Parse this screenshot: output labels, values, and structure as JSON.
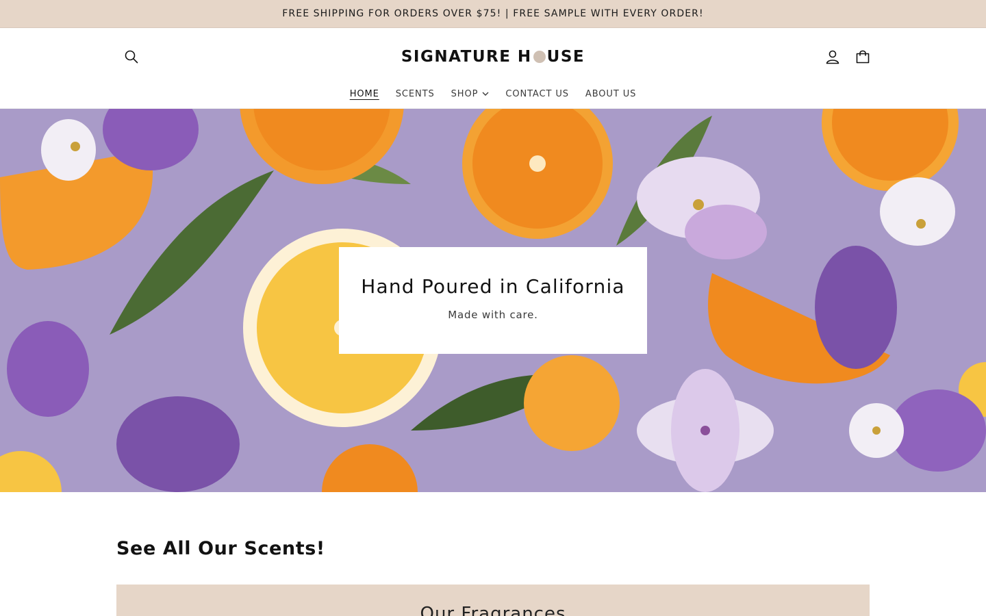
{
  "announcement": {
    "text": "FREE SHIPPING FOR ORDERS OVER $75! | FREE SAMPLE WITH EVERY ORDER!"
  },
  "header": {
    "logo_left": "SIGNATURE H",
    "logo_right": "USE",
    "icons": {
      "search": "search-icon",
      "account": "account-icon",
      "cart": "cart-icon"
    }
  },
  "nav": {
    "items": [
      {
        "label": "HOME",
        "active": true
      },
      {
        "label": "SCENTS"
      },
      {
        "label": "SHOP",
        "has_dropdown": true
      },
      {
        "label": "CONTACT US"
      },
      {
        "label": "ABOUT US"
      }
    ]
  },
  "hero": {
    "title": "Hand Poured in California",
    "subtitle": "Made with care.",
    "background_color": "#a99bc8"
  },
  "main": {
    "section_title": "See All Our Scents!",
    "band_title": "Our Fragrances",
    "band_color": "#e6d6c8"
  },
  "colors": {
    "announcement_bg": "#e6d6c8",
    "text": "#121212",
    "logo_dot": "#cfc0b3"
  }
}
